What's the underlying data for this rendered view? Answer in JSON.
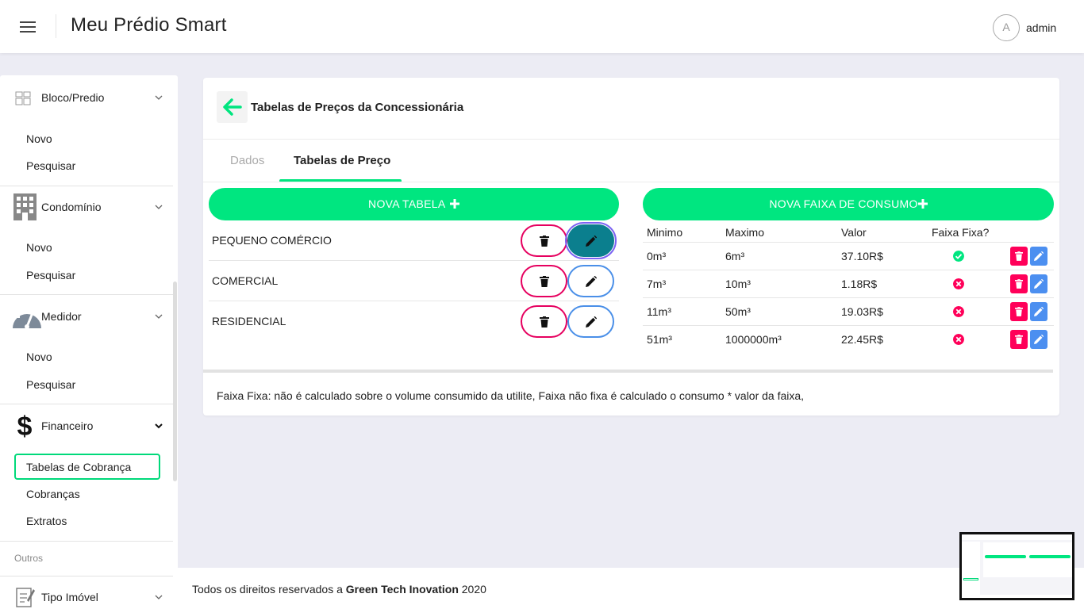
{
  "header": {
    "app_title": "Meu Prédio Smart",
    "avatar_initial": "A",
    "user_name": "admin"
  },
  "sidebar": {
    "groups": [
      {
        "label": "Bloco/Predio",
        "icon": "building-blocks-icon",
        "items": [
          "Novo",
          "Pesquisar"
        ]
      },
      {
        "label": "Condomínio",
        "icon": "office-building-icon",
        "items": [
          "Novo",
          "Pesquisar"
        ]
      },
      {
        "label": "Medidor",
        "icon": "gauge-icon",
        "items": [
          "Novo",
          "Pesquisar"
        ]
      },
      {
        "label": "Financeiro",
        "icon": "dollar-icon",
        "items": [
          "Tabelas de Cobrança",
          "Cobranças",
          "Extratos"
        ]
      }
    ],
    "active_item": "Tabelas de Cobrança",
    "section_label": "Outros",
    "extra_group": {
      "label": "Tipo Imóvel",
      "icon": "document-edit-icon"
    }
  },
  "card": {
    "title": "Tabelas de Preços da Concessionária",
    "tabs": [
      {
        "label": "Dados",
        "active": false
      },
      {
        "label": "Tabelas de Preço",
        "active": true
      }
    ],
    "nova_tabela_label": "NOVA TABELA",
    "nova_faixa_label": "NOVA FAIXA DE CONSUMO",
    "tabelas": [
      {
        "name": "PEQUENO COMÉRCIO",
        "selected": true
      },
      {
        "name": "COMERCIAL",
        "selected": false
      },
      {
        "name": "RESIDENCIAL",
        "selected": false
      }
    ],
    "faixas_headers": [
      "Minimo",
      "Maximo",
      "Valor",
      "Faixa Fixa?"
    ],
    "faixas": [
      {
        "minimo": "0m³",
        "maximo": "6m³",
        "valor": "37.10R$",
        "fixa": true
      },
      {
        "minimo": "7m³",
        "maximo": "10m³",
        "valor": "1.18R$",
        "fixa": false
      },
      {
        "minimo": "11m³",
        "maximo": "50m³",
        "valor": "19.03R$",
        "fixa": false
      },
      {
        "minimo": "51m³",
        "maximo": "1000000m³",
        "valor": "22.45R$",
        "fixa": false
      }
    ],
    "note": "Faixa Fixa: não é calculado sobre o volume consumido da utilite, Faixa não fixa é calculado o consumo * valor da faixa,"
  },
  "footer": {
    "prefix": "Todos os direitos reservados a ",
    "company": "Green Tech Inovation",
    "year": " 2020"
  },
  "colors": {
    "accent_green": "#00e680",
    "delete_red": "#ff0059",
    "edit_blue": "#4c8ff0",
    "selected_teal": "#0b7f8e",
    "focus_purple": "#7b62f2"
  }
}
